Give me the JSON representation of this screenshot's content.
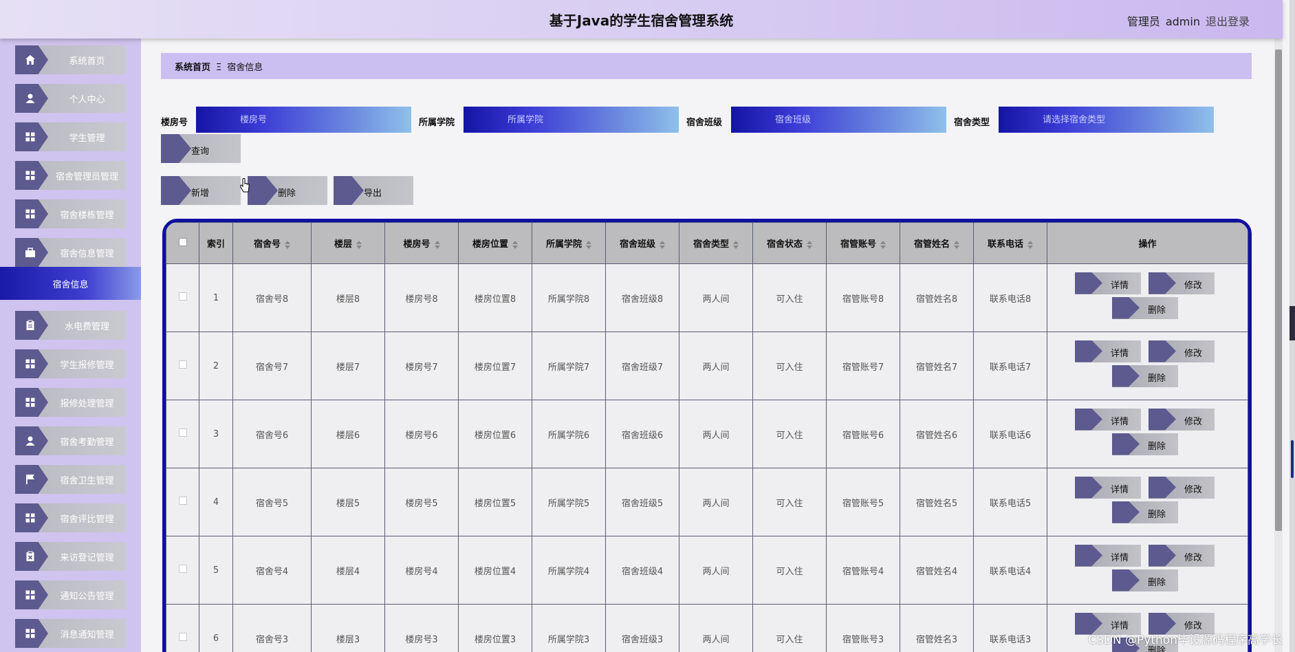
{
  "header": {
    "title": "基于Java的学生宿舍管理系统",
    "role": "管理员",
    "username": "admin",
    "logout": "退出登录"
  },
  "sidebar": {
    "items": [
      {
        "label": "系统首页",
        "icon": "home-icon"
      },
      {
        "label": "个人中心",
        "icon": "user-icon"
      },
      {
        "label": "学生管理",
        "icon": "grid-icon"
      },
      {
        "label": "宿舍管理员管理",
        "icon": "grid-icon"
      },
      {
        "label": "宿舍楼栋管理",
        "icon": "grid-icon"
      },
      {
        "label": "宿舍信息管理",
        "icon": "briefcase-icon"
      },
      {
        "label": "水电费管理",
        "icon": "clipboard-icon"
      },
      {
        "label": "学生报修管理",
        "icon": "grid-icon"
      },
      {
        "label": "报修处理管理",
        "icon": "grid-icon"
      },
      {
        "label": "宿舍考勤管理",
        "icon": "user-icon"
      },
      {
        "label": "宿舍卫生管理",
        "icon": "flag-icon"
      },
      {
        "label": "宿舍评比管理",
        "icon": "grid-icon"
      },
      {
        "label": "来访登记管理",
        "icon": "clipboard-x-icon"
      },
      {
        "label": "通知公告管理",
        "icon": "grid-icon"
      },
      {
        "label": "消息通知管理",
        "icon": "grid-icon"
      }
    ],
    "active_sub": "宿舍信息"
  },
  "breadcrumb": {
    "home": "系统首页",
    "separator": "Ξ",
    "current": "宿舍信息"
  },
  "search": {
    "fields": [
      {
        "label": "楼房号",
        "placeholder": "楼房号"
      },
      {
        "label": "所属学院",
        "placeholder": "所属学院"
      },
      {
        "label": "宿舍班级",
        "placeholder": "宿舍班级"
      },
      {
        "label": "宿舍类型",
        "placeholder": "请选择宿舍类型"
      }
    ],
    "query_label": "查询"
  },
  "actions": {
    "add": "新增",
    "delete": "删除",
    "export": "导出"
  },
  "table": {
    "columns": [
      "索引",
      "宿舍号",
      "楼层",
      "楼房号",
      "楼房位置",
      "所属学院",
      "宿舍班级",
      "宿舍类型",
      "宿舍状态",
      "宿管账号",
      "宿管姓名",
      "联系电话",
      "操作"
    ],
    "rows": [
      [
        "1",
        "宿舍号8",
        "楼层8",
        "楼房号8",
        "楼房位置8",
        "所属学院8",
        "宿舍班级8",
        "两人间",
        "可入住",
        "宿管账号8",
        "宿管姓名8",
        "联系电话8"
      ],
      [
        "2",
        "宿舍号7",
        "楼层7",
        "楼房号7",
        "楼房位置7",
        "所属学院7",
        "宿舍班级7",
        "两人间",
        "可入住",
        "宿管账号7",
        "宿管姓名7",
        "联系电话7"
      ],
      [
        "3",
        "宿舍号6",
        "楼层6",
        "楼房号6",
        "楼房位置6",
        "所属学院6",
        "宿舍班级6",
        "两人间",
        "可入住",
        "宿管账号6",
        "宿管姓名6",
        "联系电话6"
      ],
      [
        "4",
        "宿舍号5",
        "楼层5",
        "楼房号5",
        "楼房位置5",
        "所属学院5",
        "宿舍班级5",
        "两人间",
        "可入住",
        "宿管账号5",
        "宿管姓名5",
        "联系电话5"
      ],
      [
        "5",
        "宿舍号4",
        "楼层4",
        "楼房号4",
        "楼房位置4",
        "所属学院4",
        "宿舍班级4",
        "两人间",
        "可入住",
        "宿管账号4",
        "宿管姓名4",
        "联系电话4"
      ],
      [
        "6",
        "宿舍号3",
        "楼层3",
        "楼房号3",
        "楼房位置3",
        "所属学院3",
        "宿舍班级3",
        "两人间",
        "可入住",
        "宿管账号3",
        "宿管姓名3",
        "联系电话3"
      ]
    ],
    "row_actions": {
      "detail": "详情",
      "edit": "修改",
      "delete": "删除"
    }
  },
  "watermark": "CSDN @Python毕设源码程序高学长",
  "colors": {
    "header_bg": "#d8cdf2",
    "sidebar_bg": "#cfc3ef",
    "accent_blue": "#1010a0",
    "tab_purple": "#5c5a8e"
  }
}
